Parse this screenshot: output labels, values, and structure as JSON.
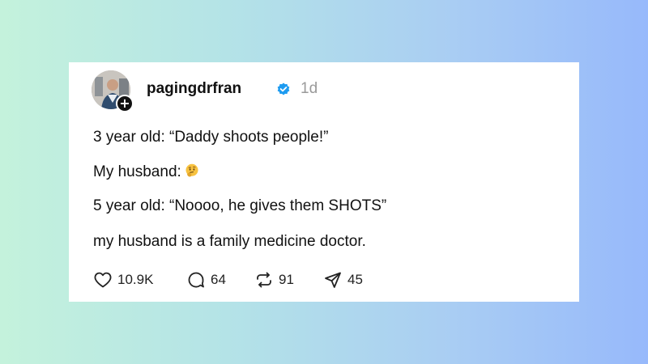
{
  "post": {
    "username": "pagingdrfran",
    "time": "1d",
    "follow_symbol": "+",
    "lines": [
      "3 year old: “Daddy shoots people!”",
      "My husband:",
      "5 year old: “Noooo, he gives them SHOTS”",
      "my husband is a family medicine doctor."
    ],
    "emoji": "thinking-face-emoji"
  },
  "actions": {
    "likes": "10.9K",
    "replies": "64",
    "reposts": "91",
    "shares": "45"
  },
  "colors": {
    "verified": "#1d9bf0",
    "text": "#111111",
    "muted": "#9a9a9a",
    "background_start": "#c4f2dc",
    "background_end": "#97b9fb"
  }
}
